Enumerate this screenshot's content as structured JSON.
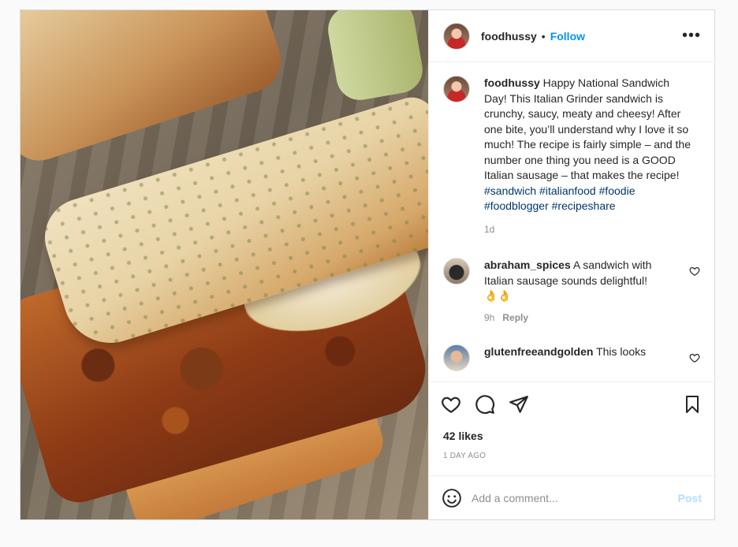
{
  "post": {
    "username": "foodhussy",
    "follow_label": "Follow",
    "separator": "•",
    "more_label": "•••"
  },
  "caption": {
    "username": "foodhussy",
    "text": " Happy National Sandwich Day! This Italian Grinder sandwich is crunchy, saucy, meaty and cheesy! After one bite, you’ll understand why I love it so much! The recipe is fairly simple – and the number one thing you need is a GOOD Italian sausage – that makes the recipe! ",
    "hashtags": [
      "#sandwich",
      "#italianfood",
      "#foodie",
      "#foodblogger",
      "#recipeshare"
    ],
    "time": "1d"
  },
  "comments": [
    {
      "username": "abraham_spices",
      "text": " A sandwich with Italian sausage sounds delightful!",
      "emoji": "👌👌",
      "time": "9h",
      "reply_label": "Reply"
    },
    {
      "username": "glutenfreeandgolden",
      "text": " This looks"
    }
  ],
  "actions": {
    "likes": "42 likes",
    "timestamp": "1 DAY AGO",
    "comment_placeholder": "Add a comment...",
    "post_label": "Post"
  }
}
